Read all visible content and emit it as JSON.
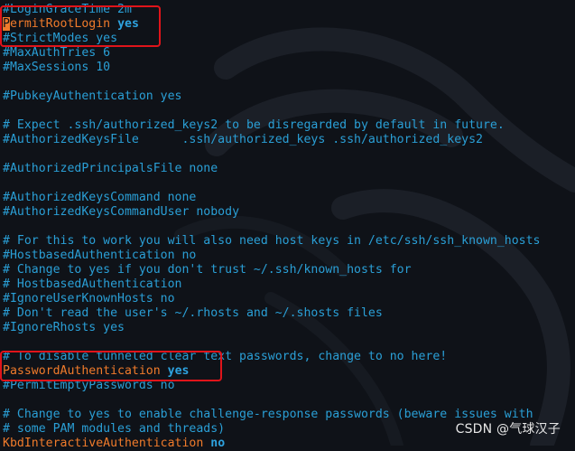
{
  "terminal": {
    "lines": [
      {
        "type": "comment",
        "text": "#LoginGraceTime 2m"
      },
      {
        "type": "directive",
        "cursor": "P",
        "key": "ermitRootLogin",
        "value": "yes"
      },
      {
        "type": "comment",
        "text": "#StrictModes yes"
      },
      {
        "type": "comment",
        "text": "#MaxAuthTries 6"
      },
      {
        "type": "comment",
        "text": "#MaxSessions 10"
      },
      {
        "type": "blank",
        "text": ""
      },
      {
        "type": "comment",
        "text": "#PubkeyAuthentication yes"
      },
      {
        "type": "blank",
        "text": ""
      },
      {
        "type": "comment",
        "text": "# Expect .ssh/authorized_keys2 to be disregarded by default in future."
      },
      {
        "type": "comment",
        "text": "#AuthorizedKeysFile      .ssh/authorized_keys .ssh/authorized_keys2"
      },
      {
        "type": "blank",
        "text": ""
      },
      {
        "type": "comment",
        "text": "#AuthorizedPrincipalsFile none"
      },
      {
        "type": "blank",
        "text": ""
      },
      {
        "type": "comment",
        "text": "#AuthorizedKeysCommand none"
      },
      {
        "type": "comment",
        "text": "#AuthorizedKeysCommandUser nobody"
      },
      {
        "type": "blank",
        "text": ""
      },
      {
        "type": "comment",
        "text": "# For this to work you will also need host keys in /etc/ssh/ssh_known_hosts"
      },
      {
        "type": "comment",
        "text": "#HostbasedAuthentication no"
      },
      {
        "type": "comment",
        "text": "# Change to yes if you don't trust ~/.ssh/known_hosts for"
      },
      {
        "type": "comment",
        "text": "# HostbasedAuthentication"
      },
      {
        "type": "comment",
        "text": "#IgnoreUserKnownHosts no"
      },
      {
        "type": "comment",
        "text": "# Don't read the user's ~/.rhosts and ~/.shosts files"
      },
      {
        "type": "comment",
        "text": "#IgnoreRhosts yes"
      },
      {
        "type": "blank",
        "text": ""
      },
      {
        "type": "comment",
        "text": "# To disable tunneled clear text passwords, change to no here!"
      },
      {
        "type": "directive",
        "cursor": "",
        "key": "PasswordAuthentication",
        "value": "yes"
      },
      {
        "type": "comment",
        "text": "#PermitEmptyPasswords no"
      },
      {
        "type": "blank",
        "text": ""
      },
      {
        "type": "comment",
        "text": "# Change to yes to enable challenge-response passwords (beware issues with"
      },
      {
        "type": "comment",
        "text": "# some PAM modules and threads)"
      },
      {
        "type": "directive",
        "cursor": "",
        "key": "KbdInteractiveAuthentication",
        "value": "no"
      }
    ],
    "highlighted_directives": [
      "PermitRootLogin",
      "PasswordAuthentication"
    ]
  },
  "watermark": "CSDN @气球汉子",
  "colors": {
    "background": "#0f1218",
    "comment": "#2a9fd6",
    "keyword": "#f07b2b",
    "value": "#2ea3e0",
    "highlight_box": "#e0141a"
  }
}
